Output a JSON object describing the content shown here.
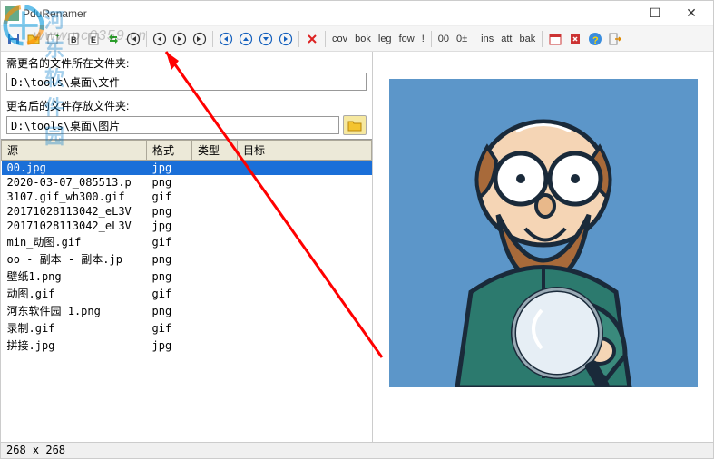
{
  "window": {
    "title": "PduRenamer",
    "min": "—",
    "max": "☐",
    "close": "✕"
  },
  "toolbar": {
    "text_buttons": [
      "cov",
      "bok",
      "leg",
      "fow",
      "!",
      "00",
      "0±",
      "ins",
      "att",
      "bak"
    ]
  },
  "paths": {
    "src_label": "需更名的文件所在文件夹:",
    "src_value": "D:\\tools\\桌面\\文件",
    "dst_label": "更名后的文件存放文件夹:",
    "dst_value": "D:\\tools\\桌面\\图片"
  },
  "table": {
    "headers": [
      "源",
      "格式",
      "类型",
      "目标"
    ],
    "rows": [
      {
        "name": "00.jpg",
        "fmt": "jpg",
        "selected": true
      },
      {
        "name": "2020-03-07_085513.p",
        "fmt": "png"
      },
      {
        "name": "3107.gif_wh300.gif",
        "fmt": "gif"
      },
      {
        "name": "20171028113042_eL3V",
        "fmt": "png"
      },
      {
        "name": "20171028113042_eL3V",
        "fmt": "jpg"
      },
      {
        "name": "min_动图.gif",
        "fmt": "gif"
      },
      {
        "name": "oo - 副本 - 副本.jp",
        "fmt": "png"
      },
      {
        "name": "壁纸1.png",
        "fmt": "png"
      },
      {
        "name": "动图.gif",
        "fmt": "gif"
      },
      {
        "name": "河东软件园_1.png",
        "fmt": "png"
      },
      {
        "name": "录制.gif",
        "fmt": "gif"
      },
      {
        "name": "拼接.jpg",
        "fmt": "jpg"
      }
    ]
  },
  "status": "268 x 268",
  "watermark": {
    "site_name": "河东软件园",
    "site_url": "www.pc0359.cn"
  }
}
